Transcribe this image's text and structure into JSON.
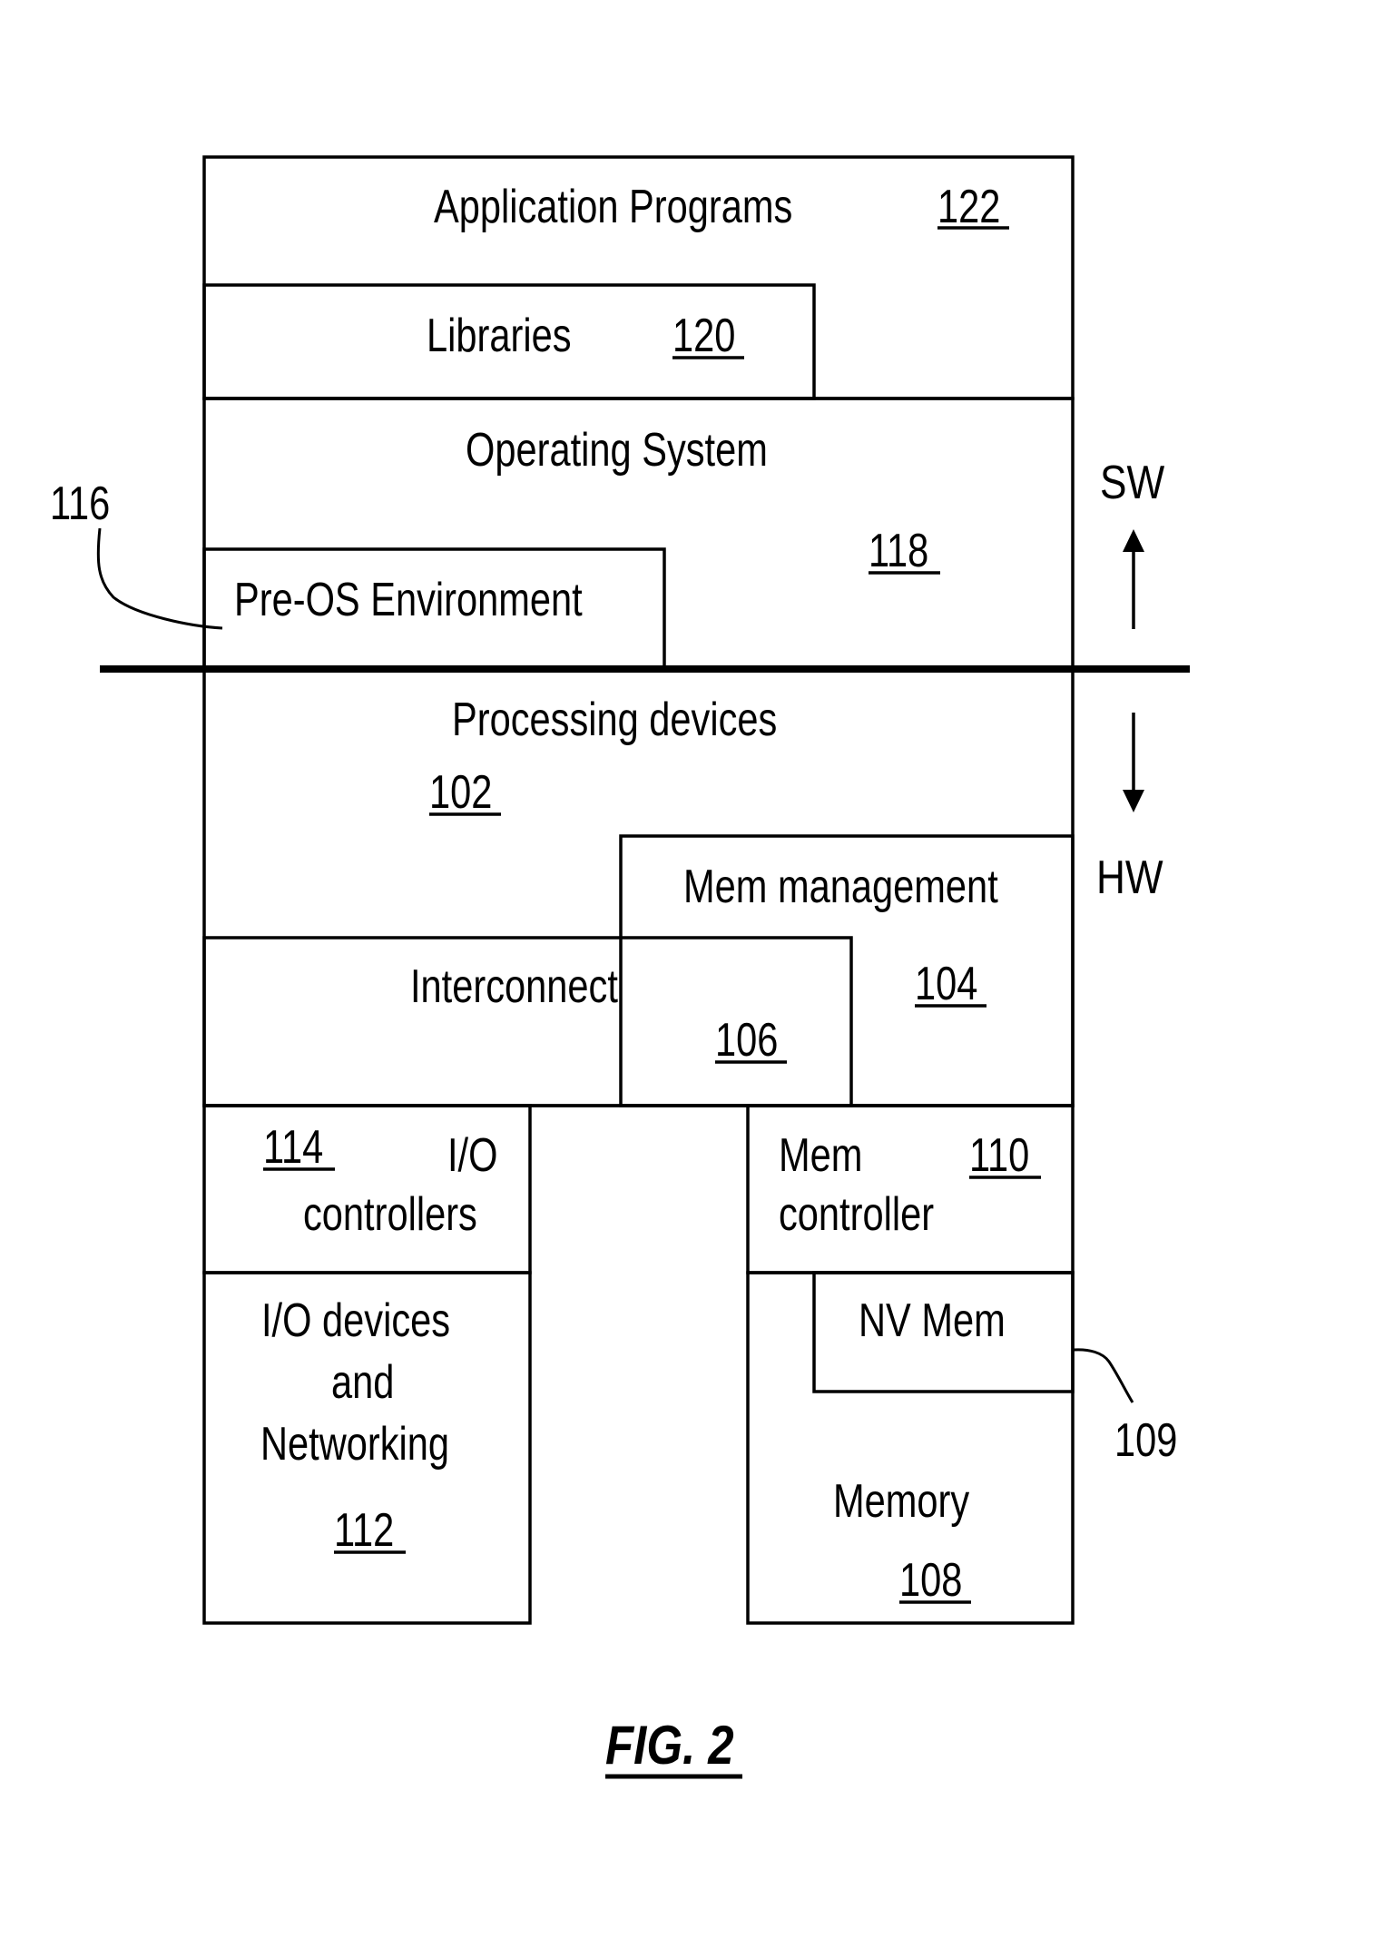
{
  "figure": {
    "caption": "FIG. 2",
    "layers": {
      "sw_label": "SW",
      "hw_label": "HW"
    },
    "blocks": {
      "application_programs": {
        "label": "Application Programs",
        "ref": "122"
      },
      "libraries": {
        "label": "Libraries",
        "ref": "120"
      },
      "operating_system": {
        "label": "Operating System",
        "ref": "118"
      },
      "pre_os_environment": {
        "label": "Pre-OS Environment",
        "ref": "116"
      },
      "processing_devices": {
        "label": "Processing devices",
        "ref": "102"
      },
      "mem_management": {
        "label": "Mem management",
        "ref": "104"
      },
      "interconnect": {
        "label": "Interconnect",
        "ref": "106"
      },
      "io_controllers": {
        "label_line1": "I/O",
        "label_line2": "controllers",
        "ref": "114"
      },
      "mem_controller": {
        "label_line1": "Mem",
        "label_line2": "controller",
        "ref": "110"
      },
      "io_devices": {
        "label_line1": "I/O devices",
        "label_line2": "and",
        "label_line3": "Networking",
        "ref": "112"
      },
      "nv_mem": {
        "label": "NV Mem",
        "ref": "109"
      },
      "memory": {
        "label": "Memory",
        "ref": "108"
      }
    }
  }
}
